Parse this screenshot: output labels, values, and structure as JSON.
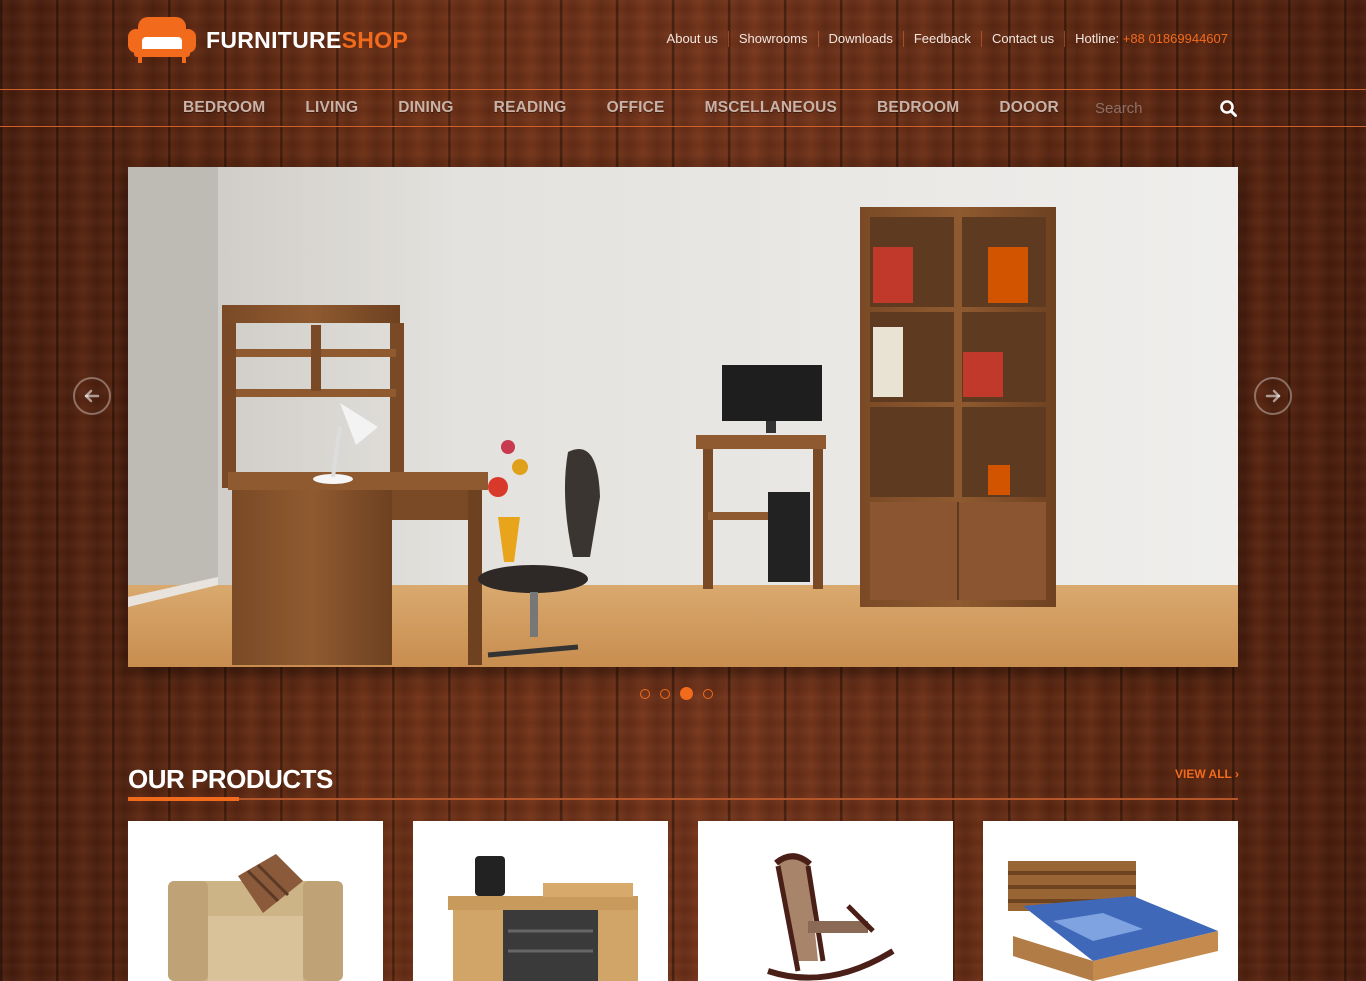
{
  "brand": {
    "name_part1": "FURNITURE",
    "name_part2": "SHOP",
    "accent_color": "#f26b1d"
  },
  "top_links": [
    "About us",
    "Showrooms",
    "Downloads",
    "Feedback",
    "Contact us"
  ],
  "hotline": {
    "label": "Hotline:",
    "number": "+88 01869944607"
  },
  "nav": {
    "items": [
      "BEDROOM",
      "LIVING",
      "DINING",
      "READING",
      "OFFICE",
      "MSCELLANEOUS",
      "BEDROOM",
      "DOOOR"
    ],
    "search_placeholder": "Search",
    "search_icon": "search-icon"
  },
  "slider": {
    "image": "study-room-furniture-photo",
    "slide_count": 4,
    "active_slide": 3,
    "prev_icon": "arrow-left-icon",
    "next_icon": "arrow-right-icon"
  },
  "products": {
    "title": "OUR PRODUCTS",
    "view_all": "VIEW ALL",
    "view_all_icon": "chevron-right-icon",
    "items": [
      {
        "image": "armchair-photo"
      },
      {
        "image": "office-desk-photo"
      },
      {
        "image": "rocking-chair-photo"
      },
      {
        "image": "wooden-bed-photo"
      }
    ]
  }
}
